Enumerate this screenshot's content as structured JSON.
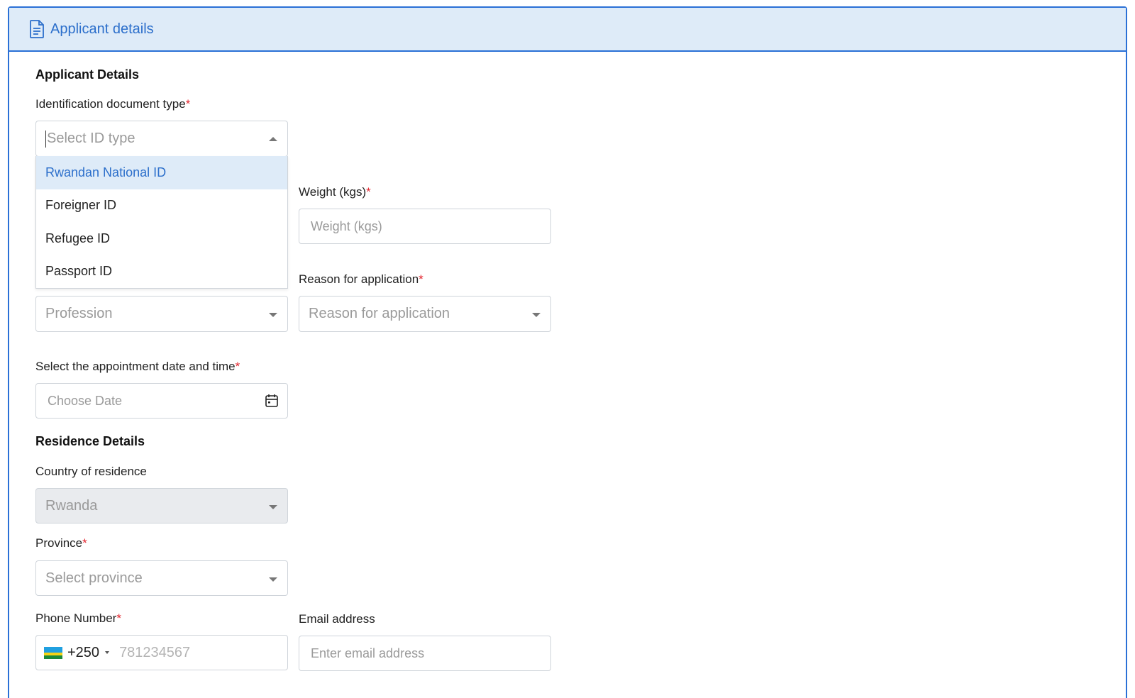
{
  "panel": {
    "title": "Applicant details",
    "icon": "document-icon"
  },
  "applicant": {
    "section_title": "Applicant Details",
    "id_type": {
      "label": "Identification document type",
      "required": "*",
      "placeholder": "Select ID type",
      "options": [
        "Rwandan National ID",
        "Foreigner ID",
        "Refugee ID",
        "Passport ID"
      ],
      "highlighted_option": "Rwandan National ID"
    },
    "weight": {
      "label": "Weight (kgs)",
      "required": "*",
      "placeholder": "Weight (kgs)"
    },
    "profession": {
      "placeholder": "Profession"
    },
    "reason": {
      "label": "Reason for application",
      "required": "*",
      "placeholder": "Reason for application"
    },
    "appointment": {
      "label": "Select the appointment date and time",
      "required": "*",
      "placeholder": "Choose Date",
      "icon": "calendar-icon"
    }
  },
  "residence": {
    "section_title": "Residence Details",
    "country": {
      "label": "Country of residence",
      "value": "Rwanda"
    },
    "province": {
      "label": "Province",
      "required": "*",
      "placeholder": "Select province"
    },
    "phone": {
      "label": "Phone Number",
      "required": "*",
      "dial_code": "+250",
      "placeholder": "781234567",
      "flag": "rwanda-flag-icon"
    },
    "email": {
      "label": "Email address",
      "placeholder": "Enter email address"
    }
  },
  "colors": {
    "accent": "#2a70d6",
    "header_bg": "#deebf8",
    "required": "#e3262f"
  }
}
